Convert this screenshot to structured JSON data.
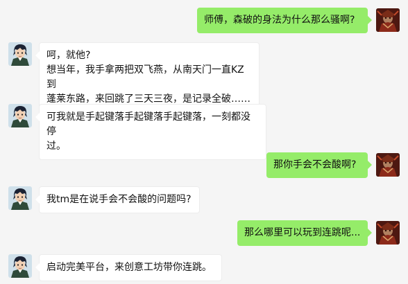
{
  "colors": {
    "background": "#f5f5f5",
    "incoming_bubble": "#ffffff",
    "outgoing_bubble": "#95ec69"
  },
  "messages": [
    {
      "side": "right",
      "avatar": "warrior-avatar",
      "text": "师傅，森破的身法为什么那么骚啊?"
    },
    {
      "side": "left",
      "avatar": "anime-guy-avatar",
      "lines": [
        "呵，就他?",
        "想当年，我手拿两把双飞燕，从南天门一直KZ到",
        "蓬莱东路，来回跳了三天三夜，是记录全破……"
      ]
    },
    {
      "side": "left",
      "avatar": "anime-guy-avatar",
      "lines": [
        "可我就是手起键落手起键落手起键落，一刻都没停",
        "过。"
      ]
    },
    {
      "side": "right",
      "avatar": "warrior-avatar",
      "text": "那你手会不会酸啊?"
    },
    {
      "side": "left",
      "avatar": "anime-guy-avatar",
      "text": "我tm是在说手会不会酸的问题吗?"
    },
    {
      "side": "right",
      "avatar": "warrior-avatar",
      "text": "那么哪里可以玩到连跳呢..."
    },
    {
      "side": "left",
      "avatar": "anime-guy-avatar",
      "text": "启动完美平台，来创意工坊带你连跳。"
    }
  ]
}
